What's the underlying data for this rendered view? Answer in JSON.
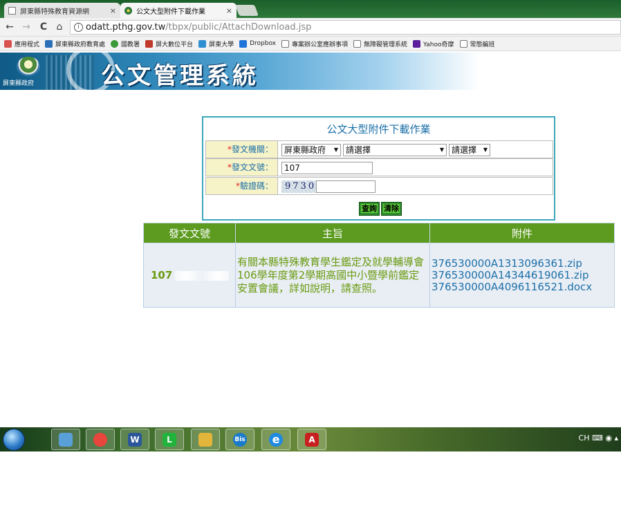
{
  "browser": {
    "tabs": [
      {
        "label": "屏東縣特殊教育資源網",
        "close": "×",
        "active": false
      },
      {
        "label": "公文大型附件下載作業",
        "close": "×",
        "active": true
      }
    ],
    "url_host": "odatt.pthg.gov.tw",
    "url_path": "/tbpx/public/AttachDownload.jsp",
    "nav": {
      "back": "←",
      "forward": "→",
      "reload": "C",
      "home": "⌂",
      "info": "i"
    },
    "bookmarks": [
      {
        "label": "應用程式",
        "color": "#d9534f"
      },
      {
        "label": "屏東縣政府教育處",
        "color": "#2a6fb8"
      },
      {
        "label": "國教署",
        "color": "#3a9a3a"
      },
      {
        "label": "屏大數位平台",
        "color": "#c0392b"
      },
      {
        "label": "屏東大學",
        "color": "#2f8fd0"
      },
      {
        "label": "Dropbox",
        "color": "#1e74d8"
      },
      {
        "label": "專案辦公室應辦事項",
        "color": "#ffffff"
      },
      {
        "label": "無障礙管理系統",
        "color": "#ffffff"
      },
      {
        "label": "Yahoo奇摩",
        "color": "#5a1e9c"
      },
      {
        "label": "常態編班",
        "color": "#ffffff"
      }
    ]
  },
  "banner": {
    "org": "屏東縣政府",
    "title": "公文管理系統"
  },
  "form": {
    "title": "公文大型附件下載作業",
    "required_mark": "*",
    "fields": {
      "agency": {
        "label": "發文機關：",
        "select1": "屏東縣政府",
        "select2": "請選擇",
        "select3": "請選擇",
        "arrow": "▼"
      },
      "doc_no": {
        "label": "發文文號：",
        "value": "107"
      },
      "captcha": {
        "label": "驗證碼：",
        "code": "9730",
        "value": ""
      }
    },
    "buttons": {
      "query": "查詢",
      "clear": "清除"
    }
  },
  "results": {
    "headers": [
      "發文文號",
      "主旨",
      "附件"
    ],
    "rows": [
      {
        "doc_no": "107",
        "subject": "有關本縣特殊教育學生鑑定及就學輔導會106學年度第2學期高國中小暨學前鑑定安置會議，詳如說明，請查照。",
        "attachments": [
          "376530000A1313096361.zip",
          "376530000A14344619061.zip",
          "376530000A4096116521.docx"
        ]
      }
    ]
  },
  "taskbar": {
    "apps": [
      {
        "name": "explorer",
        "glyph": "",
        "color": "#5aa0d8"
      },
      {
        "name": "chrome",
        "glyph": "",
        "color": "#e8453c"
      },
      {
        "name": "word",
        "glyph": "W",
        "color": "#2b579a"
      },
      {
        "name": "line",
        "glyph": "L",
        "color": "#21b33c"
      },
      {
        "name": "files",
        "glyph": "",
        "color": "#e3b53a"
      },
      {
        "name": "bis",
        "glyph": "Bis",
        "color": "#1a7acc"
      },
      {
        "name": "ie",
        "glyph": "e",
        "color": "#1f8ae0"
      },
      {
        "name": "acrobat",
        "glyph": "A",
        "color": "#c8201f"
      }
    ],
    "tray": "CH"
  }
}
